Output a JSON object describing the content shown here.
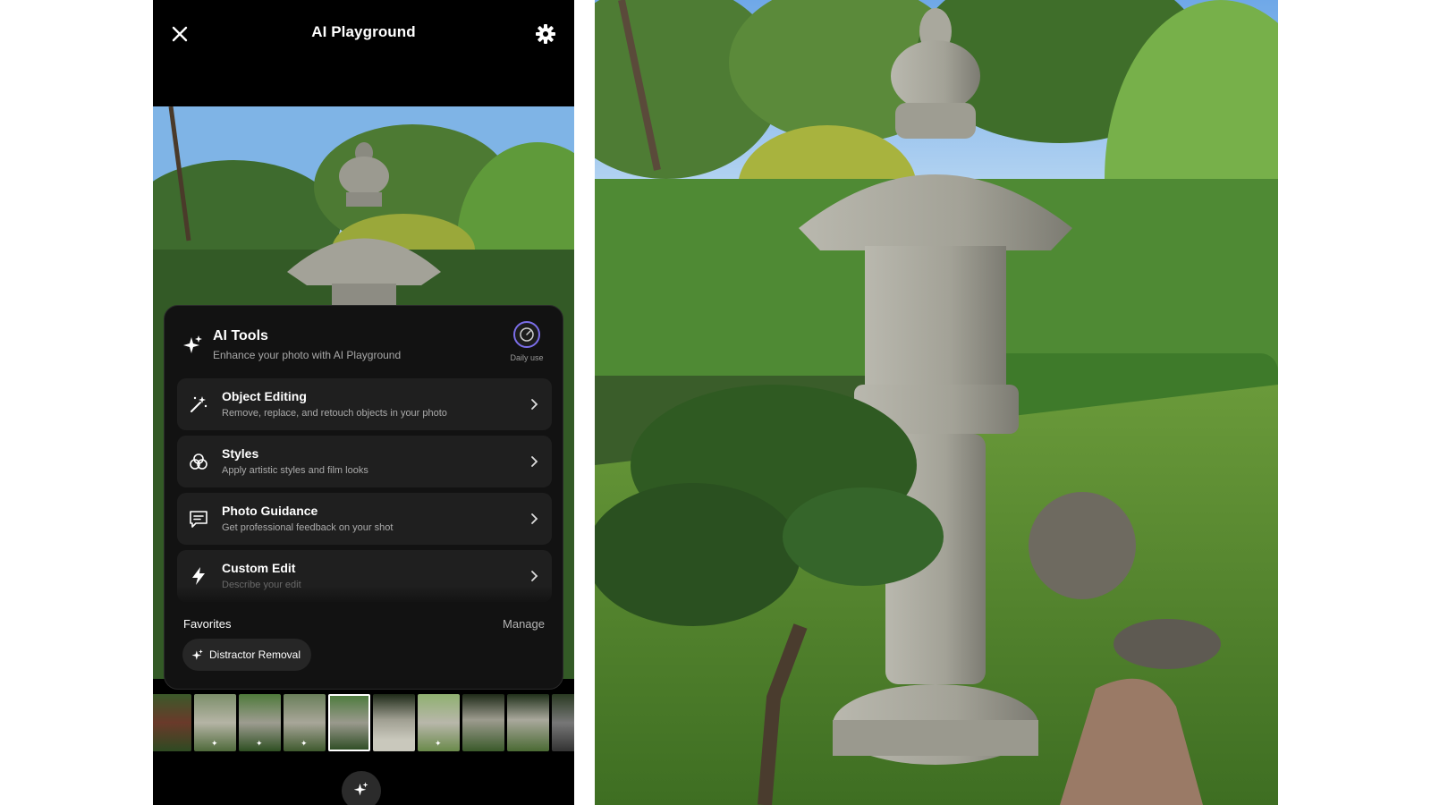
{
  "header": {
    "title": "AI Playground",
    "close_icon": "close-icon",
    "settings_icon": "gear-icon"
  },
  "ai_tools": {
    "title": "AI Tools",
    "subtitle": "Enhance your photo with AI Playground",
    "daily_use_label": "Daily use",
    "accent_color": "#7b6ee8",
    "items": [
      {
        "title": "Object Editing",
        "description": "Remove, replace, and retouch objects in your photo",
        "icon": "magic-wand-icon"
      },
      {
        "title": "Styles",
        "description": "Apply artistic styles and film looks",
        "icon": "styles-icon"
      },
      {
        "title": "Photo Guidance",
        "description": "Get professional feedback on your shot",
        "icon": "chat-icon"
      },
      {
        "title": "Custom Edit",
        "description": "Describe your edit",
        "icon": "lightning-icon"
      }
    ]
  },
  "favorites": {
    "label": "Favorites",
    "manage_label": "Manage",
    "chips": [
      {
        "label": "Distractor Removal",
        "icon": "sparkle-icon"
      }
    ]
  },
  "filmstrip": {
    "selected_index": 4
  }
}
